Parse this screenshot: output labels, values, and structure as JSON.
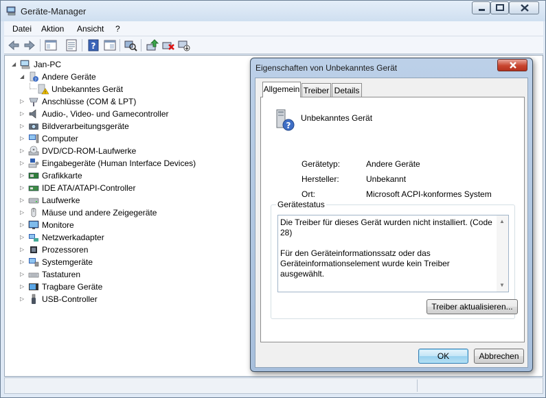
{
  "main_window": {
    "title": "Geräte-Manager",
    "menu": [
      "Datei",
      "Aktion",
      "Ansicht",
      "?"
    ]
  },
  "tree": {
    "root": "Jan-PC",
    "items": [
      {
        "label": "Andere Geräte",
        "icon": "unknown-device-icon",
        "expanded": true
      },
      {
        "label": "Unbekanntes Gerät",
        "icon": "warning-device-icon",
        "child": true
      },
      {
        "label": "Anschlüsse (COM & LPT)",
        "icon": "port-icon"
      },
      {
        "label": "Audio-, Video- und Gamecontroller",
        "icon": "speaker-icon"
      },
      {
        "label": "Bildverarbeitungsgeräte",
        "icon": "camera-icon"
      },
      {
        "label": "Computer",
        "icon": "computer-icon"
      },
      {
        "label": "DVD/CD-ROM-Laufwerke",
        "icon": "disc-drive-icon"
      },
      {
        "label": "Eingabegeräte (Human Interface Devices)",
        "icon": "input-device-icon"
      },
      {
        "label": "Grafikkarte",
        "icon": "display-adapter-icon"
      },
      {
        "label": "IDE ATA/ATAPI-Controller",
        "icon": "ide-controller-icon"
      },
      {
        "label": "Laufwerke",
        "icon": "hard-drive-icon"
      },
      {
        "label": "Mäuse und andere Zeigegeräte",
        "icon": "mouse-icon"
      },
      {
        "label": "Monitore",
        "icon": "monitor-icon"
      },
      {
        "label": "Netzwerkadapter",
        "icon": "network-adapter-icon"
      },
      {
        "label": "Prozessoren",
        "icon": "processor-icon"
      },
      {
        "label": "Systemgeräte",
        "icon": "system-device-icon"
      },
      {
        "label": "Tastaturen",
        "icon": "keyboard-icon"
      },
      {
        "label": "Tragbare Geräte",
        "icon": "portable-device-icon"
      },
      {
        "label": "USB-Controller",
        "icon": "usb-icon"
      }
    ]
  },
  "dialog": {
    "title": "Eigenschaften von Unbekanntes Gerät",
    "tabs": [
      "Allgemein",
      "Treiber",
      "Details"
    ],
    "device_name": "Unbekanntes Gerät",
    "props": {
      "type_label": "Gerätetyp:",
      "type_value": "Andere Geräte",
      "manufacturer_label": "Hersteller:",
      "manufacturer_value": "Unbekannt",
      "location_label": "Ort:",
      "location_value": "Microsoft ACPI-konformes System"
    },
    "status_title": "Gerätestatus",
    "status_text": "Die Treiber für dieses Gerät wurden nicht installiert. (Code 28)\n\nFür den Geräteinformationssatz oder das Geräteinformationselement wurde kein Treiber ausgewählt.\n\n\nKlicken Sie auf \"Treiber aktualisieren\", um einen Treiber für dieses Gerät zu finden.",
    "update_button": "Treiber aktualisieren...",
    "ok_button": "OK",
    "cancel_button": "Abbrechen"
  }
}
